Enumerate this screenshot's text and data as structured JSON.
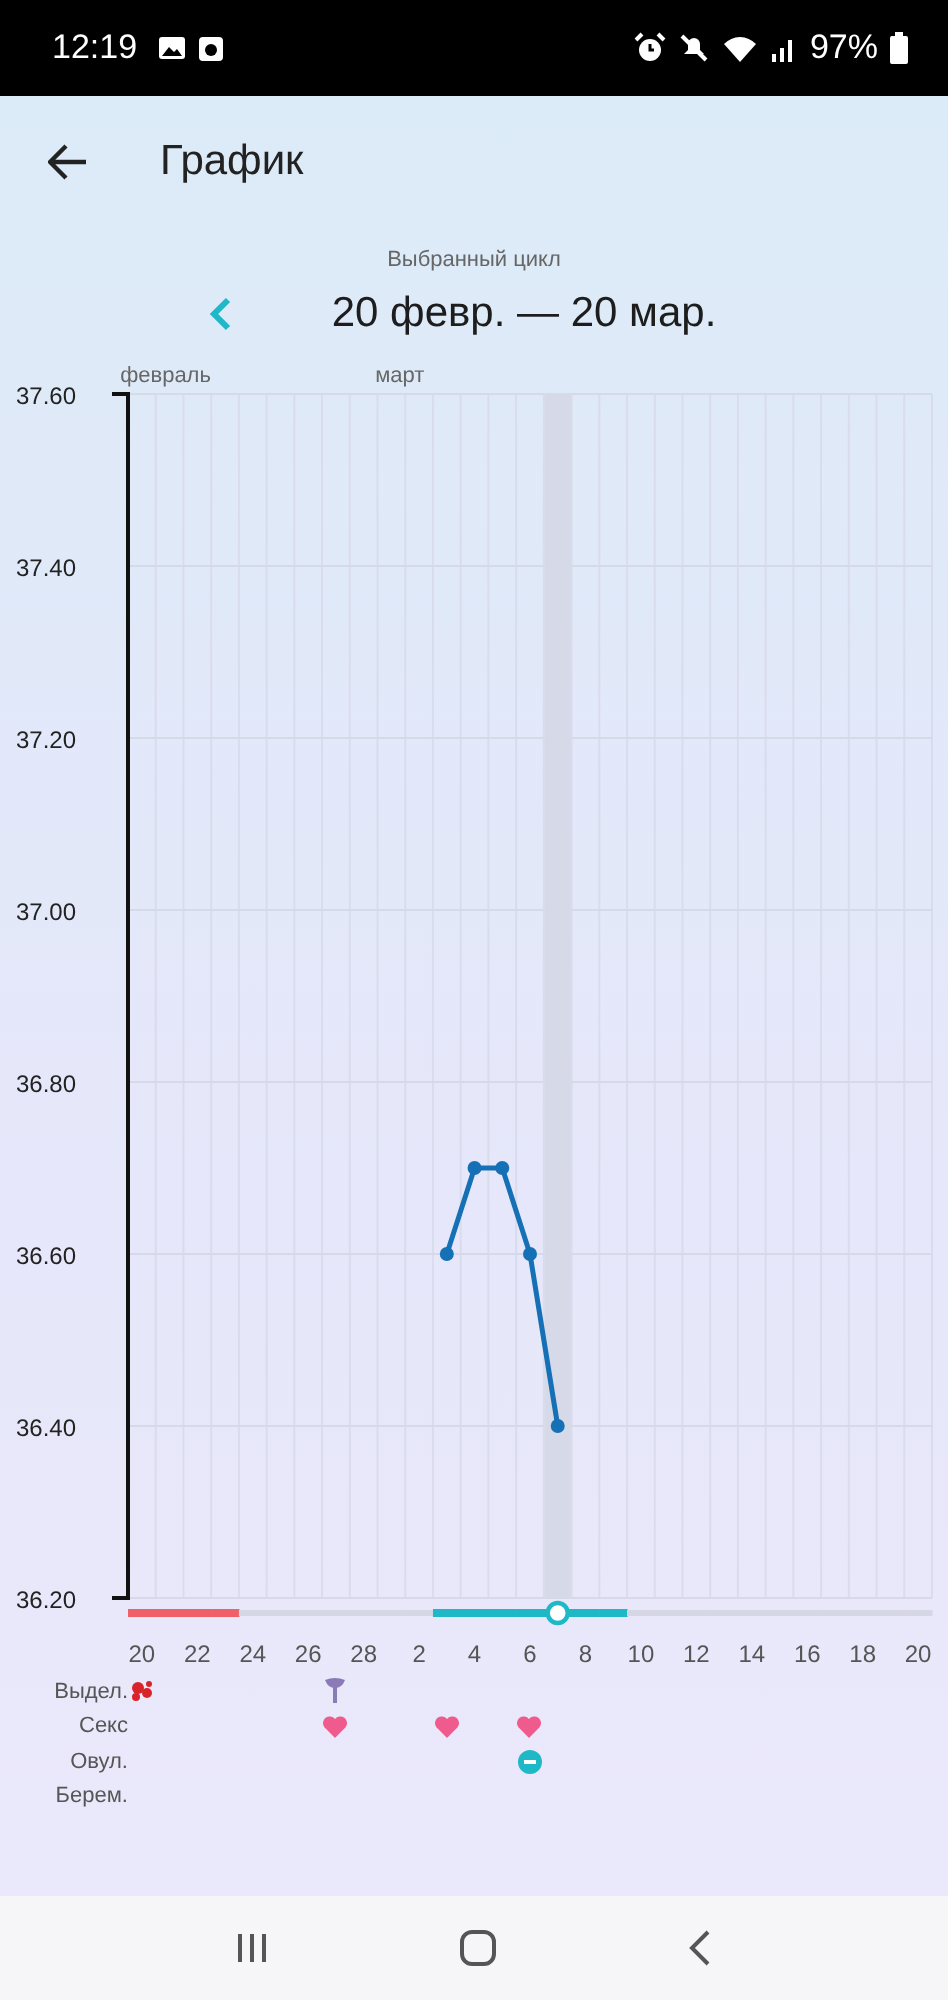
{
  "status_bar": {
    "time": "12:19",
    "battery": "97%"
  },
  "app_bar": {
    "title": "График"
  },
  "cycle": {
    "caption": "Выбранный цикл",
    "range": "20 февр. — 20 мар."
  },
  "chart": {
    "chart_data": {
      "type": "line",
      "categories": [
        "20",
        null,
        "22",
        null,
        "24",
        null,
        "26",
        null,
        "28",
        null,
        "2",
        null,
        "4",
        null,
        "6",
        null,
        "8",
        null,
        "10",
        null,
        "12",
        null,
        "14",
        null,
        "16",
        null,
        "18",
        null,
        "20"
      ],
      "grid": true,
      "series": [
        {
          "color": "#1570b5",
          "marker": true,
          "values": [
            null,
            null,
            null,
            null,
            null,
            null,
            null,
            null,
            null,
            null,
            null,
            36.6,
            36.7,
            36.7,
            36.6,
            36.4,
            null,
            null,
            null,
            null,
            null,
            null,
            null,
            null,
            null,
            null,
            null,
            null,
            null
          ]
        }
      ],
      "ylim": [
        36.2,
        37.6
      ],
      "yticks": [
        {
          "value": 37.6,
          "label": "37.60"
        },
        {
          "value": 37.4,
          "label": "37.40"
        },
        {
          "value": 37.2,
          "label": "37.20"
        },
        {
          "value": 37.0,
          "label": "37.00"
        },
        {
          "value": 36.8,
          "label": "36.80"
        },
        {
          "value": 36.6,
          "label": "36.60"
        },
        {
          "value": 36.4,
          "label": "36.40"
        },
        {
          "value": 36.2,
          "label": "36.20"
        }
      ],
      "annotations": [
        "февраль",
        "март"
      ]
    },
    "days": [
      {
        "selected": false,
        "color": "#ef6068",
        "marks": [
          {
            "kind": "blood"
          }
        ]
      },
      {
        "selected": false,
        "color": "#ef6068"
      },
      {
        "selected": false,
        "color": "#ef6068"
      },
      {
        "selected": false,
        "color": "#ef6068"
      },
      {
        "selected": false
      },
      {
        "selected": false
      },
      {
        "selected": false
      },
      {
        "selected": false,
        "marks": [
          {
            "kind": "tulip"
          },
          {
            "kind": "heart"
          }
        ]
      },
      {
        "selected": false
      },
      {
        "selected": false
      },
      {
        "selected": false
      },
      {
        "selected": false,
        "color": "#1fb8c6",
        "marks": [
          {
            "kind": "heart"
          }
        ]
      },
      {
        "selected": false,
        "color": "#1fb8c6"
      },
      {
        "selected": false,
        "color": "#1fb8c6"
      },
      {
        "selected": false,
        "color": "#1fb8c6",
        "marks": [
          {
            "kind": "heart"
          },
          {
            "kind": "ovulation"
          }
        ]
      },
      {
        "selected": true,
        "color": "#1fb8c6"
      },
      {
        "selected": false,
        "color": "#1fb8c6"
      },
      {
        "selected": false,
        "color": "#1fb8c6"
      },
      {
        "selected": false
      },
      {
        "selected": false
      },
      {
        "selected": false
      },
      {
        "selected": false
      },
      {
        "selected": false
      },
      {
        "selected": false
      },
      {
        "selected": false
      },
      {
        "selected": false
      },
      {
        "selected": false
      },
      {
        "selected": false
      },
      {
        "selected": false
      }
    ]
  },
  "event_rows": [
    {
      "label": "Выдел."
    },
    {
      "label": "Секс"
    },
    {
      "label": "Овул."
    },
    {
      "label": "Берем."
    }
  ]
}
